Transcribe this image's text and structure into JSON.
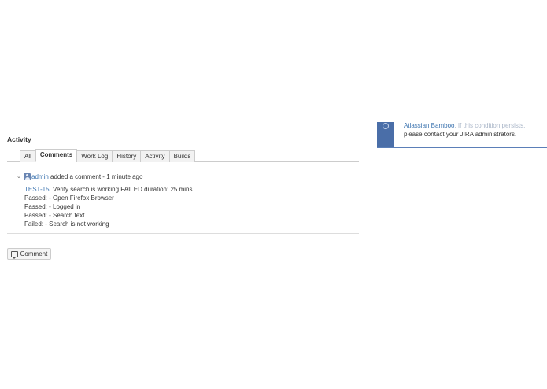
{
  "activity": {
    "heading": "Activity",
    "tabs": [
      {
        "label": "All",
        "active": false
      },
      {
        "label": "Comments",
        "active": true
      },
      {
        "label": "Work Log",
        "active": false
      },
      {
        "label": "History",
        "active": false
      },
      {
        "label": "Activity",
        "active": false
      },
      {
        "label": "Builds",
        "active": false
      }
    ],
    "comment": {
      "toggle": "⌄",
      "author": "admin",
      "action": "added a comment -",
      "time": "1 minute ago",
      "issue_key": "TEST-15",
      "summary": "Verify search is working FAILED duration: 25 mins",
      "lines": [
        "Passed: - Open Firefox Browser",
        "Passed: - Logged in",
        "Passed: - Search text",
        "Failed: - Search is not working"
      ]
    },
    "comment_button_label": "Comment"
  },
  "notification": {
    "line1_link": "Atlassian Bamboo",
    "line1_rest": ". If this condition persists,",
    "line2": "please contact your JIRA administrators."
  },
  "icons": {
    "avatar": "user-avatar-icon",
    "comment": "speech-bubble-icon",
    "notification": "info-icon"
  },
  "colors": {
    "link": "#3b73af",
    "notification_bar": "#4a6ea8"
  }
}
